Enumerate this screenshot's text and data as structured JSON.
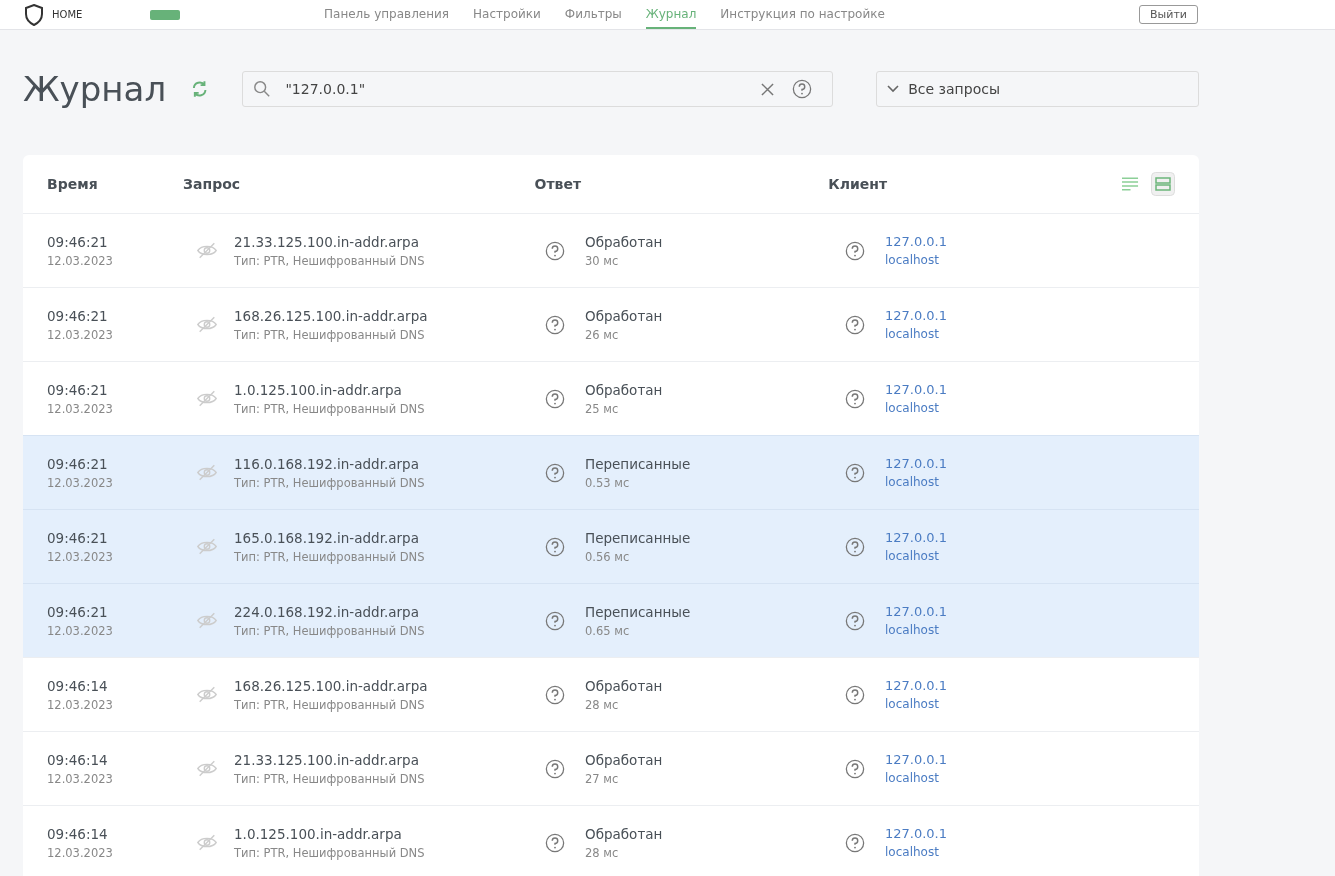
{
  "header": {
    "logo_sub": "HOME",
    "nav": [
      {
        "label": "Панель управления",
        "selected": false
      },
      {
        "label": "Настройки",
        "selected": false
      },
      {
        "label": "Фильтры",
        "selected": false
      },
      {
        "label": "Журнал",
        "selected": true
      },
      {
        "label": "Инструкция по настройке",
        "selected": false
      }
    ],
    "logout": "Выйти"
  },
  "page": {
    "title": "Журнал",
    "search": {
      "value": "\"127.0.0.1\""
    },
    "filter": "Все запросы"
  },
  "table": {
    "columns": [
      "Время",
      "Запрос",
      "Ответ",
      "Клиент"
    ],
    "rows": [
      {
        "time": "09:46:21",
        "date": "12.03.2023",
        "domain": "21.33.125.100.in-addr.arpa",
        "type": "Тип: PTR, Нешифрованный DNS",
        "status": "Обработан",
        "elapsed": "30 мс",
        "ip": "127.0.0.1",
        "host": "localhost",
        "highlighted": false
      },
      {
        "time": "09:46:21",
        "date": "12.03.2023",
        "domain": "168.26.125.100.in-addr.arpa",
        "type": "Тип: PTR, Нешифрованный DNS",
        "status": "Обработан",
        "elapsed": "26 мс",
        "ip": "127.0.0.1",
        "host": "localhost",
        "highlighted": false
      },
      {
        "time": "09:46:21",
        "date": "12.03.2023",
        "domain": "1.0.125.100.in-addr.arpa",
        "type": "Тип: PTR, Нешифрованный DNS",
        "status": "Обработан",
        "elapsed": "25 мс",
        "ip": "127.0.0.1",
        "host": "localhost",
        "highlighted": false
      },
      {
        "time": "09:46:21",
        "date": "12.03.2023",
        "domain": "116.0.168.192.in-addr.arpa",
        "type": "Тип: PTR, Нешифрованный DNS",
        "status": "Переписанные",
        "elapsed": "0.53 мс",
        "ip": "127.0.0.1",
        "host": "localhost",
        "highlighted": true
      },
      {
        "time": "09:46:21",
        "date": "12.03.2023",
        "domain": "165.0.168.192.in-addr.arpa",
        "type": "Тип: PTR, Нешифрованный DNS",
        "status": "Переписанные",
        "elapsed": "0.56 мс",
        "ip": "127.0.0.1",
        "host": "localhost",
        "highlighted": true
      },
      {
        "time": "09:46:21",
        "date": "12.03.2023",
        "domain": "224.0.168.192.in-addr.arpa",
        "type": "Тип: PTR, Нешифрованный DNS",
        "status": "Переписанные",
        "elapsed": "0.65 мс",
        "ip": "127.0.0.1",
        "host": "localhost",
        "highlighted": true
      },
      {
        "time": "09:46:14",
        "date": "12.03.2023",
        "domain": "168.26.125.100.in-addr.arpa",
        "type": "Тип: PTR, Нешифрованный DNS",
        "status": "Обработан",
        "elapsed": "28 мс",
        "ip": "127.0.0.1",
        "host": "localhost",
        "highlighted": false
      },
      {
        "time": "09:46:14",
        "date": "12.03.2023",
        "domain": "21.33.125.100.in-addr.arpa",
        "type": "Тип: PTR, Нешифрованный DNS",
        "status": "Обработан",
        "elapsed": "27 мс",
        "ip": "127.0.0.1",
        "host": "localhost",
        "highlighted": false
      },
      {
        "time": "09:46:14",
        "date": "12.03.2023",
        "domain": "1.0.125.100.in-addr.arpa",
        "type": "Тип: PTR, Нешифрованный DNS",
        "status": "Обработан",
        "elapsed": "28 мс",
        "ip": "127.0.0.1",
        "host": "localhost",
        "highlighted": false
      }
    ]
  }
}
